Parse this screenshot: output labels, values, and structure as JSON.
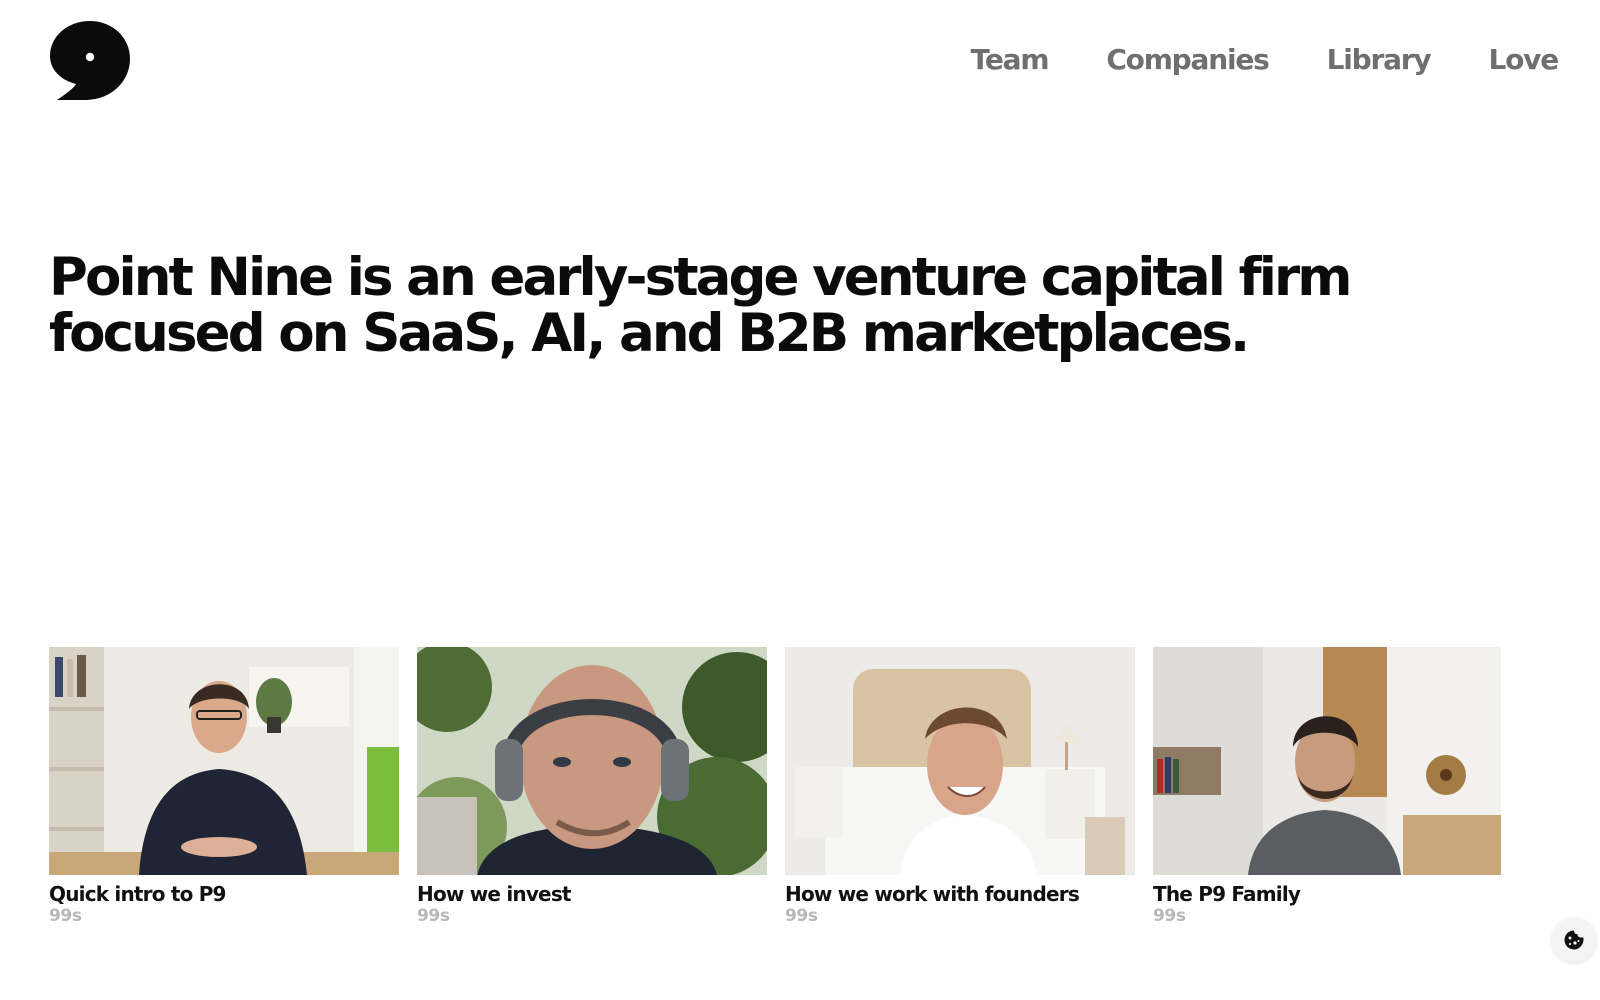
{
  "brand": {
    "logo_icon": "point-nine-logo-icon"
  },
  "nav": {
    "items": [
      {
        "label": "Team"
      },
      {
        "label": "Companies"
      },
      {
        "label": "Library"
      },
      {
        "label": "Love"
      }
    ]
  },
  "hero": {
    "headline": "Point Nine is an early-stage venture capital firm focused on SaaS, AI, and B2B marketplaces."
  },
  "videos": [
    {
      "title": "Quick intro to P9",
      "duration": "99s"
    },
    {
      "title": "How we invest",
      "duration": "99s"
    },
    {
      "title": "How we work with founders",
      "duration": "99s"
    },
    {
      "title": "The P9 Family",
      "duration": "99s"
    }
  ],
  "cookie_button": {
    "icon": "cookie-icon"
  }
}
